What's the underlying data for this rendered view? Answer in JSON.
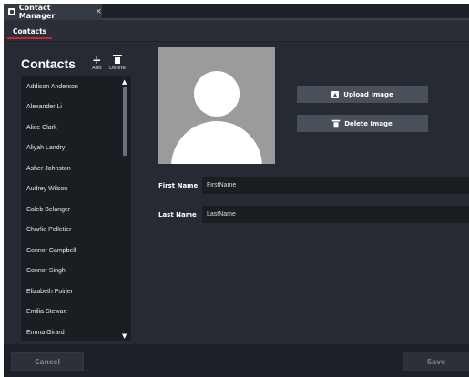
{
  "window": {
    "tab_title": "Contact Manager",
    "tab_close": "×"
  },
  "subtabs": [
    "Contacts"
  ],
  "left_panel": {
    "title": "Contacts",
    "add_label": "Add",
    "delete_label": "Delete",
    "contacts": [
      "Addison Anderson",
      "Alexander Li",
      "Alice Clark",
      "Aliyah Landry",
      "Asher Johnston",
      "Audrey Wilson",
      "Caleb Belanger",
      "Charlie Pelletier",
      "Connor Campbell",
      "Connor Singh",
      "Elizabeth Poirier",
      "Emilia Stewart",
      "Emma Girard"
    ]
  },
  "image_actions": {
    "upload_label": "Upload Image",
    "delete_label": "Delete Image"
  },
  "form": {
    "first_name_label": "First Name",
    "first_name_value": "FirstName",
    "last_name_label": "Last Name",
    "last_name_value": "LastName"
  },
  "footer": {
    "cancel_label": "Cancel",
    "save_label": "Save"
  },
  "colors": {
    "accent": "#c2282f",
    "background": "#262b33",
    "list_background": "#1a1d22"
  }
}
